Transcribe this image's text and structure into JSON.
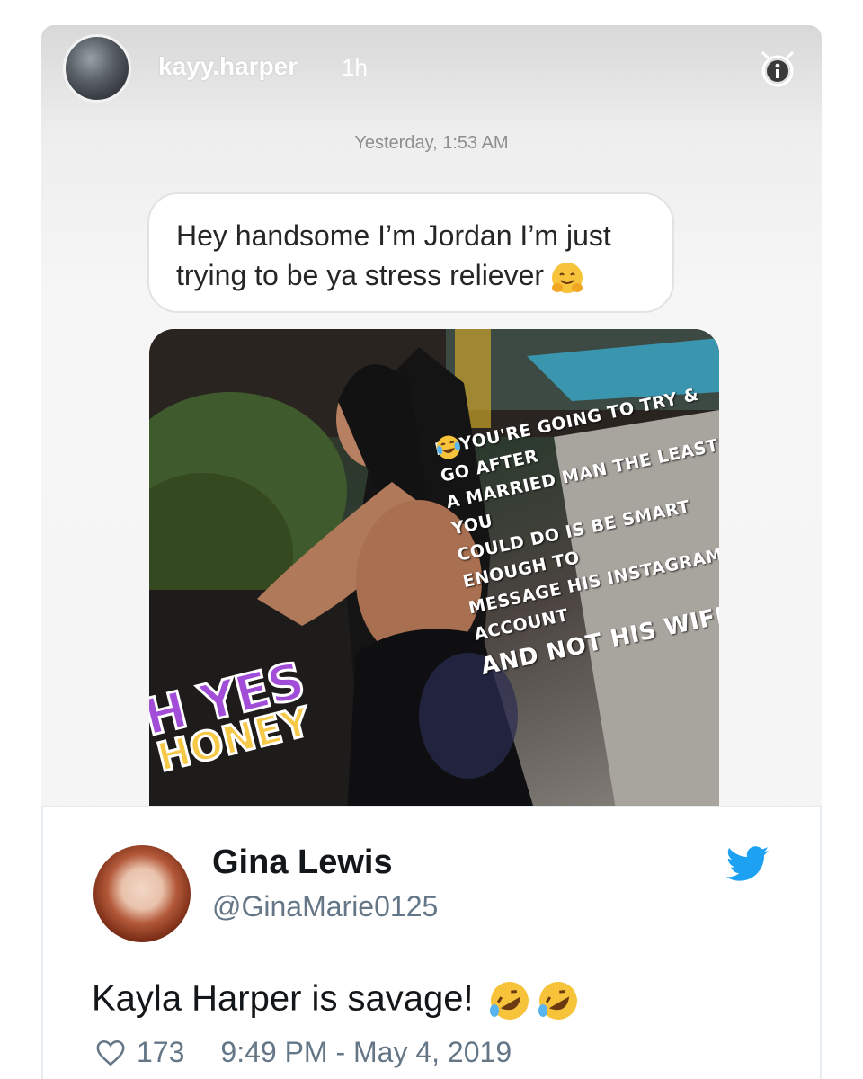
{
  "story": {
    "username": "kayy.harper",
    "time_ago": "1h",
    "message_timestamp": "Yesterday, 1:53 AM",
    "message_line1": "Hey handsome I’m Jordan I’m just",
    "message_line2": "trying to be ya stress reliever",
    "message_emoji": "hugging-face",
    "overlay_lines": [
      "If you're going to try & go after",
      "a married man the least you",
      "could do is be smart enough to",
      "message his Instagram account"
    ],
    "overlay_last": "and not his wife's",
    "sticker_top": "OH YES",
    "sticker_bottom": "HONEY"
  },
  "tweet": {
    "name": "Gina Lewis",
    "handle": "@GinaMarie0125",
    "text": "Kayla Harper is savage!",
    "text_emoji": "rolling-on-floor-laughing x2",
    "likes": "173",
    "datetime": "9:49 PM - May 4, 2019"
  },
  "colors": {
    "twitter_blue": "#1da1f2",
    "sticker_purple": "#a24dd8",
    "sticker_yellow": "#f7c948",
    "text_gray": "#657786"
  }
}
